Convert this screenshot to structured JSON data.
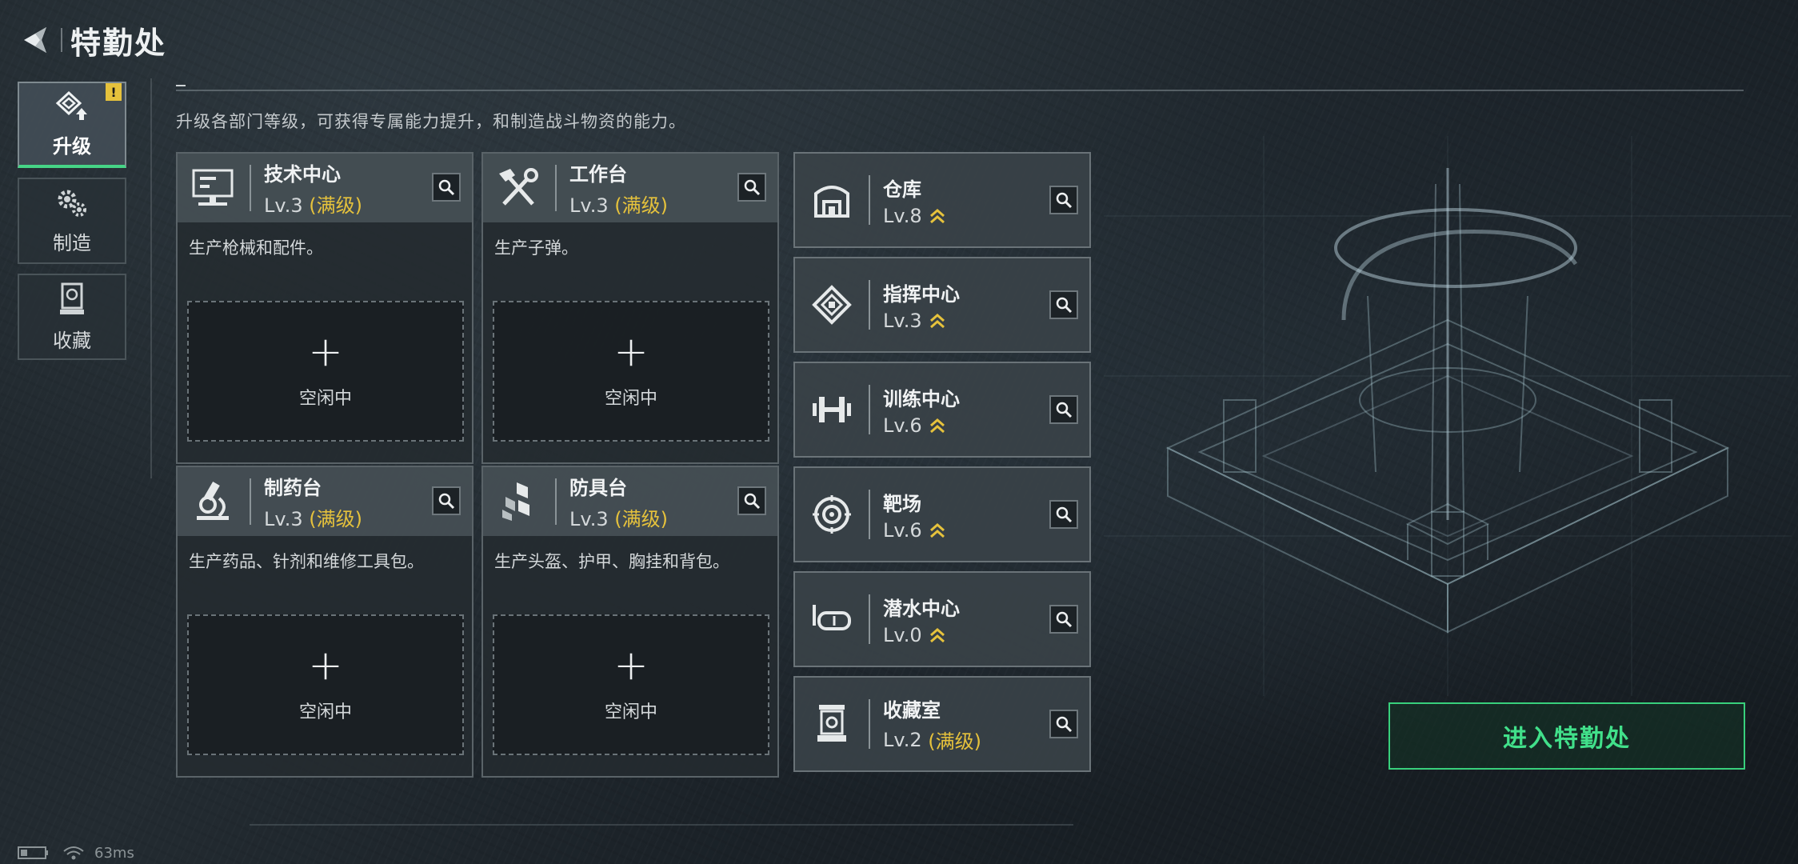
{
  "header": {
    "title": "特勤处"
  },
  "nav": {
    "tabs": [
      {
        "label": "升级",
        "icon": "upgrade-icon",
        "active": true,
        "alert": "!"
      },
      {
        "label": "制造",
        "icon": "gears-icon",
        "active": false
      },
      {
        "label": "收藏",
        "icon": "collection-icon",
        "active": false
      }
    ]
  },
  "description": "升级各部门等级，可获得专属能力提升，和制造战斗物资的能力。",
  "departments": [
    {
      "name": "技术中心",
      "level": "Lv.3",
      "status": "(满级)",
      "desc": "生产枪械和配件。",
      "icon": "computer-icon",
      "idle_label": "空闲中",
      "plus": "+"
    },
    {
      "name": "工作台",
      "level": "Lv.3",
      "status": "(满级)",
      "desc": "生产子弹。",
      "icon": "tools-icon",
      "idle_label": "空闲中",
      "plus": "+"
    },
    {
      "name": "制药台",
      "level": "Lv.3",
      "status": "(满级)",
      "desc": "生产药品、针剂和维修工具包。",
      "icon": "microscope-icon",
      "idle_label": "空闲中",
      "plus": "+"
    },
    {
      "name": "防具台",
      "level": "Lv.3",
      "status": "(满级)",
      "desc": "生产头盔、护甲、胸挂和背包。",
      "icon": "armor-blocks-icon",
      "idle_label": "空闲中",
      "plus": "+"
    }
  ],
  "facilities": [
    {
      "name": "仓库",
      "level": "Lv.8",
      "status": "",
      "upgradable": true,
      "icon": "warehouse-icon"
    },
    {
      "name": "指挥中心",
      "level": "Lv.3",
      "status": "",
      "upgradable": true,
      "icon": "chip-icon"
    },
    {
      "name": "训练中心",
      "level": "Lv.6",
      "status": "",
      "upgradable": true,
      "icon": "dumbbell-icon"
    },
    {
      "name": "靶场",
      "level": "Lv.6",
      "status": "",
      "upgradable": true,
      "icon": "target-icon"
    },
    {
      "name": "潜水中心",
      "level": "Lv.0",
      "status": "",
      "upgradable": true,
      "icon": "diving-mask-icon"
    },
    {
      "name": "收藏室",
      "level": "Lv.2",
      "status": "(满级)",
      "upgradable": false,
      "icon": "display-case-icon"
    }
  ],
  "enter_button": "进入特勤处",
  "status_bar": {
    "ping": "63ms"
  },
  "colors": {
    "accent_green": "#41e08a",
    "maxed_gold": "#e6c23c",
    "alert_yellow": "#e6c23c"
  }
}
